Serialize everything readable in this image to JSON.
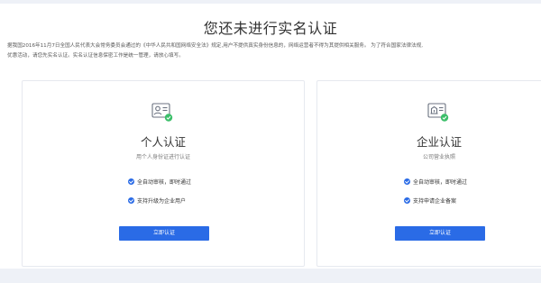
{
  "page": {
    "title": "您还未进行实名认证",
    "notice_lines": [
      "据我国2016年11月7日全国人民代表大会常务委员会通过的《中华人民共和国网络安全法》规定,用户不提供真实身份信息的，网络运营者不得为其提供相关服务。 为了符合国家法律法规,",
      "优惠活动，请您先实名认证。实名认证信息保密工作是统一管理，请放心填写。"
    ]
  },
  "cards": [
    {
      "title": "个人认证",
      "subtitle": "用个人身份证进行认证",
      "icon": "id-card-icon",
      "features": [
        "全自动审核，即时通过",
        "支持升级为企业用户"
      ],
      "button_label": "立即认证"
    },
    {
      "title": "企业认证",
      "subtitle": "公司营业执照",
      "icon": "business-license-icon",
      "features": [
        "全自动审核，即时通过",
        "支持申请企业备案"
      ],
      "button_label": "立即认证"
    }
  ],
  "colors": {
    "accent": "#2a6be6",
    "check_badge": "#3cbf6a",
    "background": "#eef1f7"
  }
}
